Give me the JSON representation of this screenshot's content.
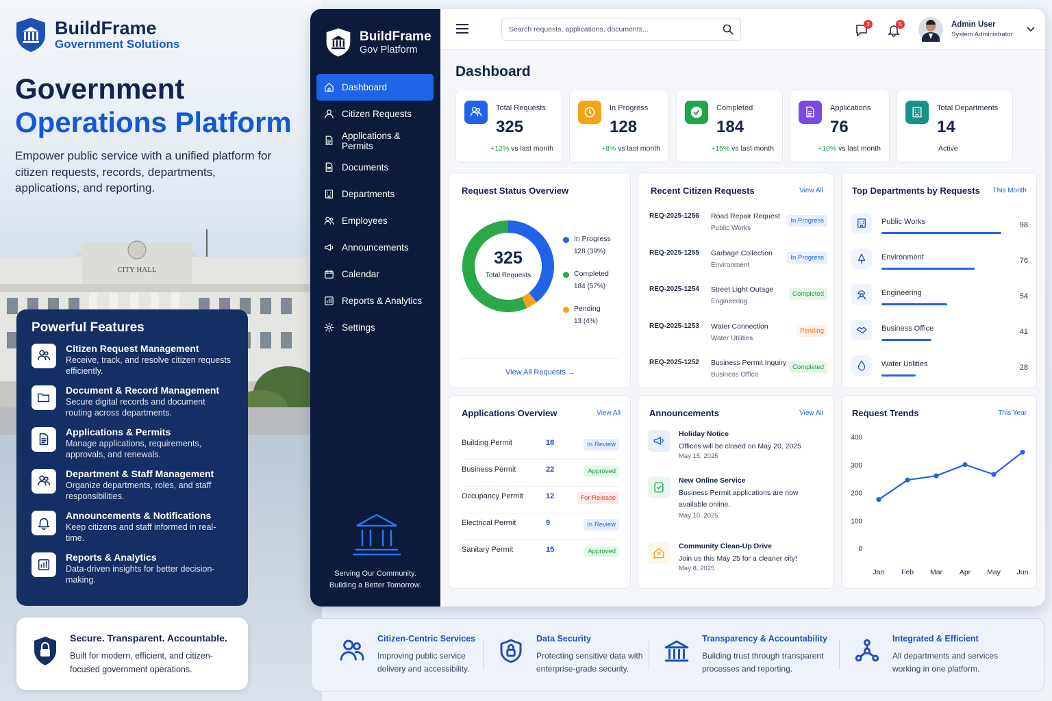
{
  "hero": {
    "brand_name": "BuildFrame",
    "brand_sub": "Government Solutions",
    "title_line1": "Government",
    "title_line2": "Operations Platform",
    "lead": "Empower public service with a unified platform for citizen requests, records, departments, applications, and reporting.",
    "building_sign": "CITY HALL",
    "features_title": "Powerful Features",
    "features": [
      {
        "icon": "users-icon",
        "title": "Citizen Request Management",
        "desc": "Receive, track, and resolve citizen requests efficiently."
      },
      {
        "icon": "folder-icon",
        "title": "Document & Record Management",
        "desc": "Secure digital records and document routing across departments."
      },
      {
        "icon": "document-icon",
        "title": "Applications & Permits",
        "desc": "Manage applications, requirements, approvals, and renewals."
      },
      {
        "icon": "team-icon",
        "title": "Department & Staff Management",
        "desc": "Organize departments, roles, and staff responsibilities."
      },
      {
        "icon": "bell-icon",
        "title": "Announcements & Notifications",
        "desc": "Keep citizens and staff informed in real-time."
      },
      {
        "icon": "chart-icon",
        "title": "Reports & Analytics",
        "desc": "Data-driven insights for better decision-making."
      }
    ],
    "secure_title": "Secure. Transparent. Accountable.",
    "secure_desc": "Built for modern, efficient, and citizen-focused government operations."
  },
  "sidebar": {
    "logo_name": "BuildFrame",
    "logo_sub": "Gov Platform",
    "items": [
      {
        "label": "Dashboard",
        "icon": "home-icon",
        "active": true
      },
      {
        "label": "Citizen Requests",
        "icon": "user-icon"
      },
      {
        "label": "Applications & Permits",
        "icon": "document-icon"
      },
      {
        "label": "Documents",
        "icon": "file-icon"
      },
      {
        "label": "Departments",
        "icon": "building-icon"
      },
      {
        "label": "Employees",
        "icon": "employees-icon"
      },
      {
        "label": "Announcements",
        "icon": "megaphone-icon"
      },
      {
        "label": "Calendar",
        "icon": "calendar-icon"
      },
      {
        "label": "Reports & Analytics",
        "icon": "chart-icon"
      },
      {
        "label": "Settings",
        "icon": "gear-icon"
      }
    ],
    "footer_line1": "Serving Our Community.",
    "footer_line2": "Building a Better Tomorrow."
  },
  "topbar": {
    "search_placeholder": "Search requests, applications, documents...",
    "messages_count": "3",
    "notifications_count": "5",
    "user_name": "Admin User",
    "user_role": "System Administrator"
  },
  "page_title": "Dashboard",
  "stats": [
    {
      "label": "Total Requests",
      "value": "325",
      "change": "+12%",
      "change_text": " vs last month",
      "color": "#1f63e6"
    },
    {
      "label": "In Progress",
      "value": "128",
      "change": "+8%",
      "change_text": " vs last month",
      "color": "#f2a516"
    },
    {
      "label": "Completed",
      "value": "184",
      "change": "+15%",
      "change_text": " vs last month",
      "color": "#1fa64a"
    },
    {
      "label": "Applications",
      "value": "76",
      "change": "+10%",
      "change_text": " vs last month",
      "color": "#7a4be0"
    },
    {
      "label": "Total Departments",
      "value": "14",
      "change": "",
      "change_text": "Active",
      "color": "#16938a"
    }
  ],
  "status_overview": {
    "title": "Request Status Overview",
    "center_value": "325",
    "center_label": "Total Requests",
    "legend": [
      {
        "name": "In Progress",
        "detail": "128 (39%)",
        "color": "#1f63e6",
        "value": 128
      },
      {
        "name": "Completed",
        "detail": "184 (57%)",
        "color": "#2aa84a",
        "value": 184
      },
      {
        "name": "Pending",
        "detail": "13 (4%)",
        "color": "#f2a516",
        "value": 13
      }
    ],
    "link": "View All Requests"
  },
  "recent_requests": {
    "title": "Recent Citizen Requests",
    "link": "View All",
    "rows": [
      {
        "id": "REQ-2025-1256",
        "name": "Road Repair Request",
        "dept": "Public Works",
        "status": "In Progress",
        "cls": "p-blue"
      },
      {
        "id": "REQ-2025-1255",
        "name": "Garbage Collection",
        "dept": "Environment",
        "status": "In Progress",
        "cls": "p-blue"
      },
      {
        "id": "REQ-2025-1254",
        "name": "Street Light Outage",
        "dept": "Engineering",
        "status": "Completed",
        "cls": "p-green"
      },
      {
        "id": "REQ-2025-1253",
        "name": "Water Connection",
        "dept": "Water Utilities",
        "status": "Pending",
        "cls": "p-orange"
      },
      {
        "id": "REQ-2025-1252",
        "name": "Business Permit Inquiry",
        "dept": "Business Office",
        "status": "Completed",
        "cls": "p-green"
      }
    ]
  },
  "top_departments": {
    "title": "Top Departments by Requests",
    "link": "This Month",
    "rows": [
      {
        "name": "Public Works",
        "value": 98,
        "icon": "building-icon"
      },
      {
        "name": "Environment",
        "value": 76,
        "icon": "tree-icon"
      },
      {
        "name": "Engineering",
        "value": 54,
        "icon": "engineer-icon"
      },
      {
        "name": "Business Office",
        "value": 41,
        "icon": "handshake-icon"
      },
      {
        "name": "Water Utilities",
        "value": 28,
        "icon": "water-icon"
      }
    ]
  },
  "applications": {
    "title": "Applications Overview",
    "link": "View All",
    "rows": [
      {
        "name": "Building Permit",
        "value": "18",
        "status": "In Review",
        "cls": "p-blue"
      },
      {
        "name": "Business Permit",
        "value": "22",
        "status": "Approved",
        "cls": "p-green"
      },
      {
        "name": "Occupancy Permit",
        "value": "12",
        "status": "For Release",
        "cls": "p-red"
      },
      {
        "name": "Electrical Permit",
        "value": "9",
        "status": "In Review",
        "cls": "p-blue"
      },
      {
        "name": "Sanitary Permit",
        "value": "15",
        "status": "Approved",
        "cls": "p-green"
      }
    ]
  },
  "announcements": {
    "title": "Announcements",
    "link": "View All",
    "items": [
      {
        "title": "Holiday Notice",
        "desc": "Offices will be closed on May 20, 2025",
        "date": "May 15, 2025",
        "icon": "megaphone-icon",
        "color": "#1f63e6"
      },
      {
        "title": "New Online Service",
        "desc": "Business Permit applications are now available online.",
        "date": "May 10, 2025",
        "icon": "online-service-icon",
        "color": "#1fa64a"
      },
      {
        "title": "Community Clean-Up Drive",
        "desc": "Join us this May 25 for a cleaner city!",
        "date": "May 8, 2025",
        "icon": "community-icon",
        "color": "#f2a516"
      }
    ]
  },
  "chart_data": {
    "type": "line",
    "title": "Request Trends",
    "period": "This Year",
    "categories": [
      "Jan",
      "Feb",
      "Mar",
      "Apr",
      "May",
      "Jun"
    ],
    "values": [
      175,
      245,
      260,
      300,
      265,
      345
    ],
    "ylim": [
      0,
      400
    ],
    "yticks": [
      0,
      100,
      200,
      300,
      400
    ],
    "grid": false,
    "color": "#1f63e6"
  },
  "strip": [
    {
      "icon": "citizens-icon",
      "title": "Citizen-Centric Services",
      "desc": "Improving public service delivery and accessibility."
    },
    {
      "icon": "shield-lock-icon",
      "title": "Data Security",
      "desc": "Protecting sensitive data with enterprise-grade security."
    },
    {
      "icon": "institution-icon",
      "title": "Transparency & Accountability",
      "desc": "Building trust through transparent processes and reporting."
    },
    {
      "icon": "network-icon",
      "title": "Integrated & Efficient",
      "desc": "All departments and services working in one platform."
    }
  ]
}
